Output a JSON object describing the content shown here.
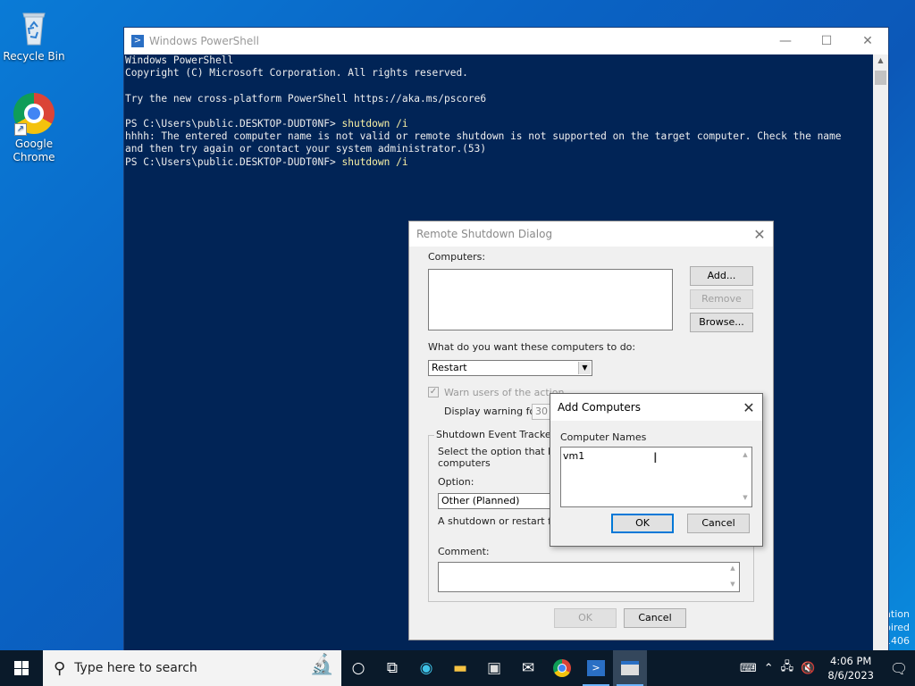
{
  "desktop": {
    "icons": [
      {
        "label": "Recycle Bin"
      },
      {
        "label": "Google Chrome"
      }
    ],
    "watermark": [
      "ation",
      "pired",
      "1406"
    ]
  },
  "powershell": {
    "title": "Windows PowerShell",
    "lines": [
      {
        "text": "Windows PowerShell"
      },
      {
        "text": "Copyright (C) Microsoft Corporation. All rights reserved."
      },
      {
        "text": ""
      },
      {
        "text": "Try the new cross-platform PowerShell https://aka.ms/pscore6"
      },
      {
        "text": ""
      },
      {
        "prompt": "PS C:\\Users\\public.DESKTOP-DUDT0NF> ",
        "cmd": "shutdown /i"
      },
      {
        "text": "hhhh: The entered computer name is not valid or remote shutdown is not supported on the target computer. Check the name"
      },
      {
        "text": "and then try again or contact your system administrator.(53)"
      },
      {
        "prompt": "PS C:\\Users\\public.DESKTOP-DUDT0NF> ",
        "cmd": "shutdown /i"
      }
    ]
  },
  "remote_dialog": {
    "title": "Remote Shutdown Dialog",
    "computers_label": "Computers:",
    "add_button": "Add...",
    "remove_button": "Remove",
    "browse_button": "Browse...",
    "action_label": "What do you want these computers to do:",
    "action_value": "Restart",
    "warn_label": "Warn users of the action",
    "display_warning_label": "Display warning for",
    "display_warning_value": "30",
    "tracker_legend": "Shutdown Event Tracker",
    "tracker_desc_line1": "Select the option that best",
    "tracker_desc_line2": "computers",
    "option_label": "Option:",
    "option_value": "Other (Planned)",
    "option_desc": "A shutdown or restart for ar",
    "comment_label": "Comment:",
    "ok_button": "OK",
    "cancel_button": "Cancel"
  },
  "add_dialog": {
    "title": "Add Computers",
    "names_label": "Computer Names",
    "names_value": "vm1",
    "ok_button": "OK",
    "cancel_button": "Cancel"
  },
  "taskbar": {
    "search_placeholder": "Type here to search",
    "time": "4:06 PM",
    "date": "8/6/2023"
  }
}
